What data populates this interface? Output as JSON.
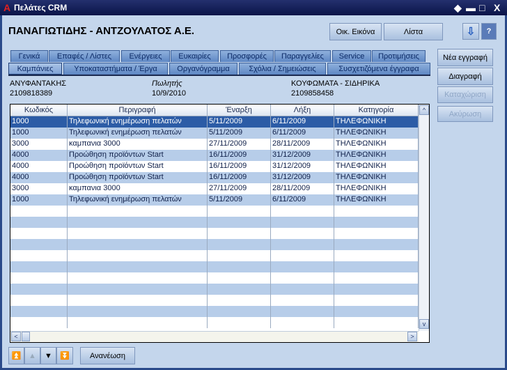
{
  "window": {
    "title": "Πελάτες CRM",
    "controls": [
      "◆",
      "▬",
      "□",
      "X"
    ]
  },
  "header": {
    "company": "ΠΑΝΑΓΙΩΤΙΔΗΣ - ΑΝΤΖΟΥΛΑΤΟΣ Α.Ε.",
    "btn_family": "Οικ. Εικόνα",
    "btn_list": "Λίστα",
    "icon_sort": "sort-down-icon",
    "icon_help": "help-icon"
  },
  "tabs_row1": [
    "Γενικά",
    "Επαφές / Λίστες",
    "Ενέργειες",
    "Ευκαιρίες",
    "Προσφορές",
    "Παραγγελίες",
    "Service",
    "Προτιμήσεις"
  ],
  "tabs_row2": [
    "Καμπάνιες",
    "Υποκαταστήματα / Έργα",
    "Οργανόγραμμα",
    "Σχόλια / Σημειώσεις",
    "Συσχετιζόμενα έγγραφα"
  ],
  "active_tab": "Καμπάνιες",
  "actions": {
    "new": "Νέα εγγραφή",
    "delete": "Διαγραφή",
    "save": "Καταχώριση",
    "cancel": "Ακύρωση"
  },
  "info": {
    "name": "ΑΝΥΦΑΝΤΑΚΗΣ",
    "role": "Πωλητής",
    "category": "ΚΟΥΦΩΜΑΤΑ - ΣΙΔΗΡΙΚΑ",
    "phone1": "2109818389",
    "date": "10/9/2010",
    "phone2": "2109858458"
  },
  "table": {
    "columns": [
      "Κωδικός",
      "Περιγραφή",
      "Έναρξη",
      "Λήξη",
      "Κατηγορία"
    ],
    "rows": [
      [
        "1000",
        "Τηλεφωνική ενημέρωση πελατών",
        "5/11/2009",
        "6/11/2009",
        "ΤΗΛΕΦΩΝΙΚΗ"
      ],
      [
        "1000",
        "Τηλεφωνική ενημέρωση πελατών",
        "5/11/2009",
        "6/11/2009",
        "ΤΗΛΕΦΩΝΙΚΗ"
      ],
      [
        "3000",
        "καμπανια 3000",
        "27/11/2009",
        "28/11/2009",
        "ΤΗΛΕΦΩΝΙΚΗ"
      ],
      [
        "4000",
        "Προώθηση προϊόντων Start",
        "16/11/2009",
        "31/12/2009",
        "ΤΗΛΕΦΩΝΙΚΗ"
      ],
      [
        "4000",
        "Προώθηση προϊόντων Start",
        "16/11/2009",
        "31/12/2009",
        "ΤΗΛΕΦΩΝΙΚΗ"
      ],
      [
        "4000",
        "Προώθηση προϊόντων Start",
        "16/11/2009",
        "31/12/2009",
        "ΤΗΛΕΦΩΝΙΚΗ"
      ],
      [
        "3000",
        "καμπανια 3000",
        "27/11/2009",
        "28/11/2009",
        "ΤΗΛΕΦΩΝΙΚΗ"
      ],
      [
        "1000",
        "Τηλεφωνική ενημέρωση πελατών",
        "5/11/2009",
        "6/11/2009",
        "ΤΗΛΕΦΩΝΙΚΗ"
      ]
    ],
    "selected_row": 0
  },
  "footer": {
    "refresh": "Ανανέωση",
    "nav": [
      "⏫",
      "▲",
      "▼",
      "⏬"
    ]
  }
}
